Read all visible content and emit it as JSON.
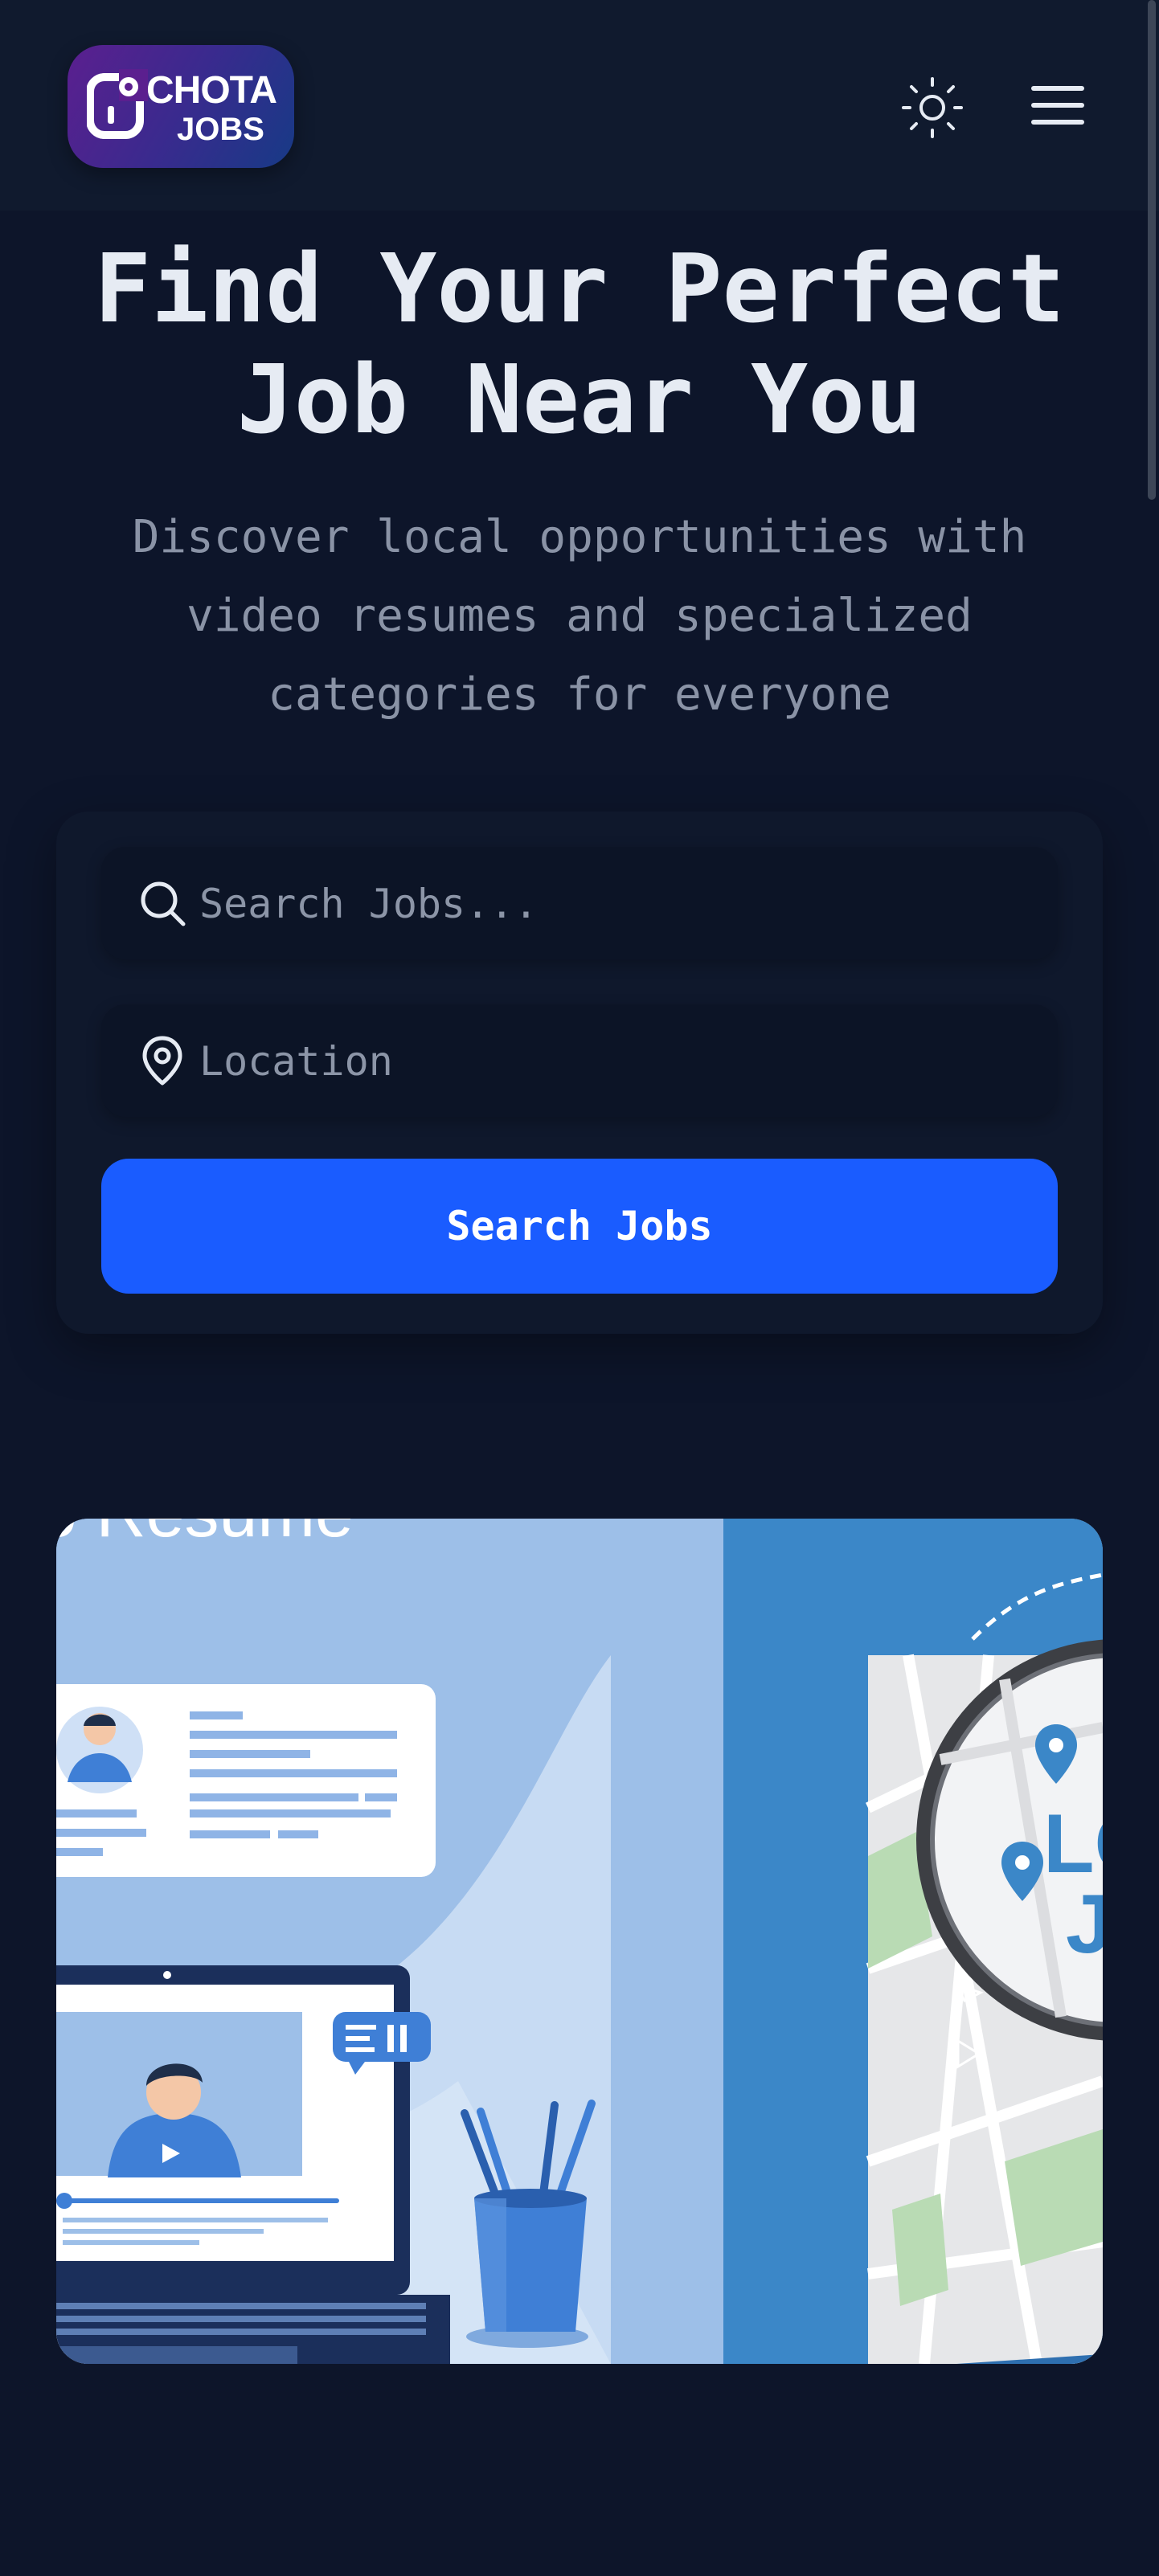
{
  "header": {
    "logo_text_1": "CHOTA",
    "logo_text_2": "JOBS",
    "theme_toggle_icon": "sun-icon",
    "menu_icon": "hamburger-menu-icon"
  },
  "hero": {
    "title": "Find Your Perfect Job Near You",
    "subtitle": "Discover local opportunities with video resumes and specialized categories for everyone"
  },
  "search": {
    "keyword_placeholder": "Search Jobs...",
    "location_placeholder": "Location",
    "button_label": "Search Jobs",
    "search_icon": "search-icon",
    "location_icon": "map-pin-icon"
  },
  "banner": {
    "partial_title": "eo Resume",
    "map_letters": "LO J"
  },
  "colors": {
    "background": "#0d152a",
    "header": "#101a2e",
    "accent": "#1a5cff",
    "muted_text": "#8a93a6"
  }
}
